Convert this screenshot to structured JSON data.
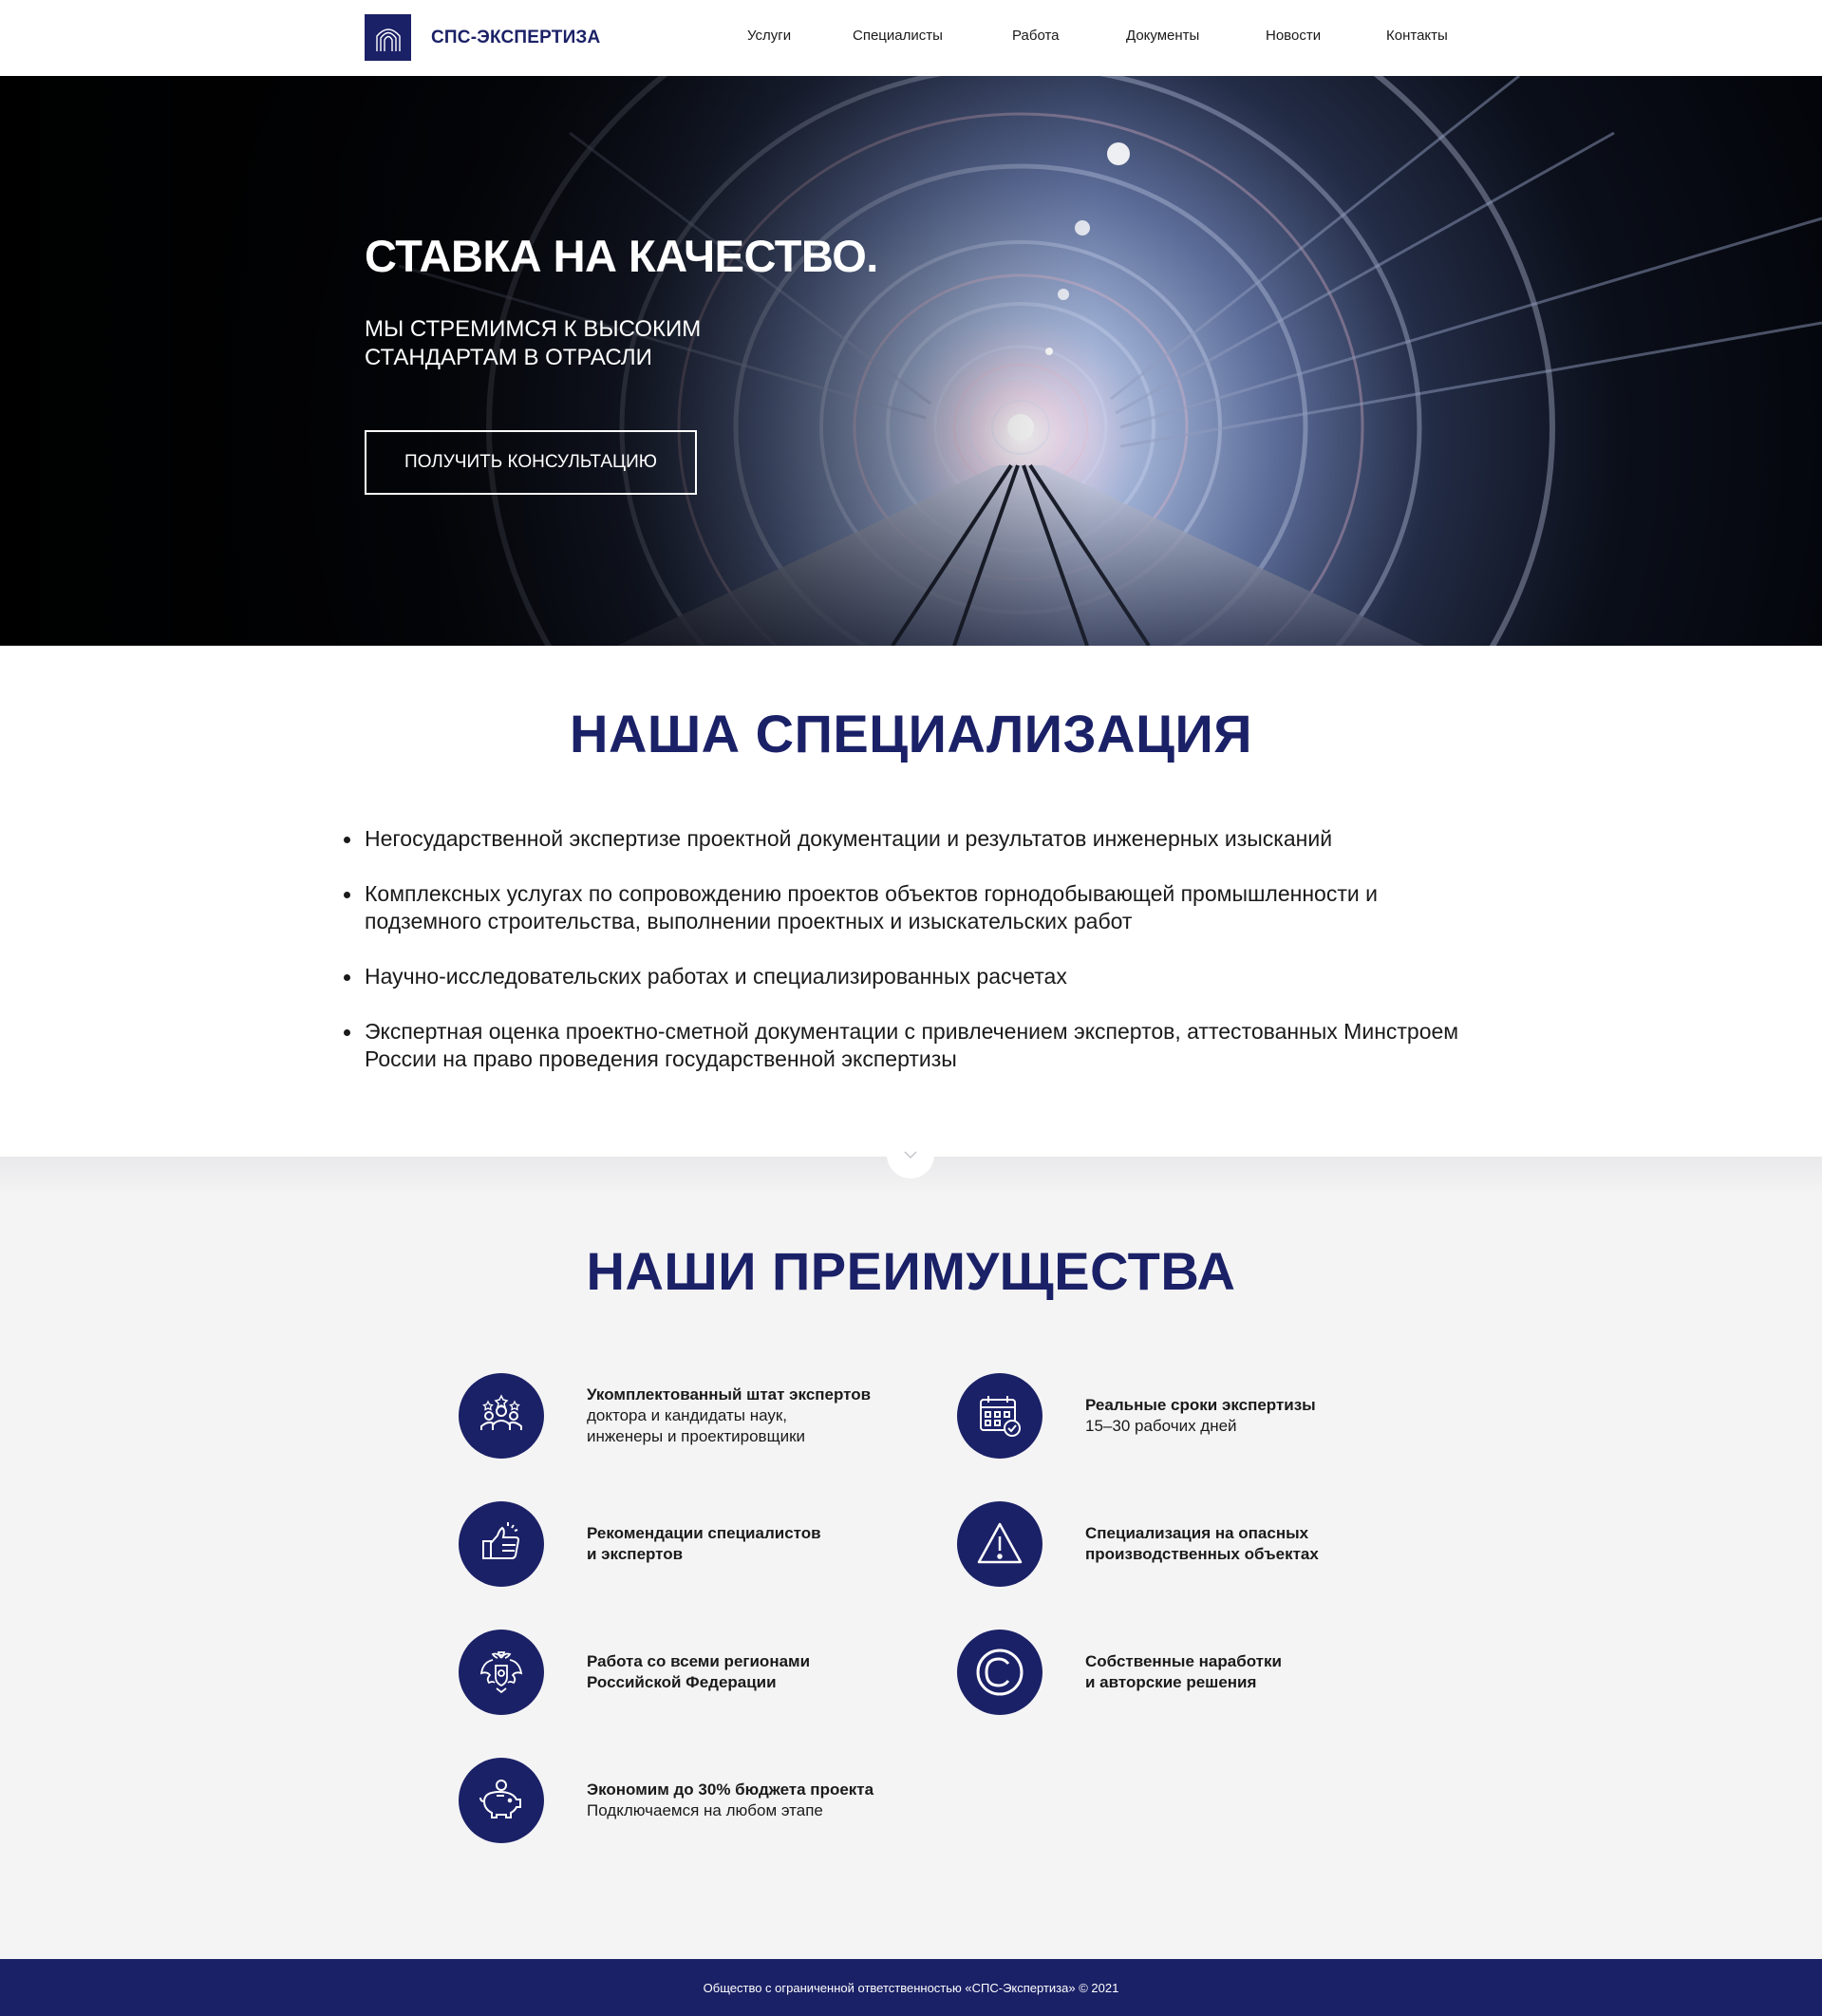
{
  "header": {
    "logo_text": "СПС-ЭКСПЕРТИЗА",
    "nav": [
      "Услуги",
      "Специалисты",
      "Работа",
      "Документы",
      "Новости",
      "Контакты"
    ]
  },
  "hero": {
    "title": "СТАВКА НА КАЧЕСТВО.",
    "subtitle": "МЫ СТРЕМИМСЯ К ВЫСОКИМ СТАНДАРТАМ В ОТРАСЛИ",
    "button": "ПОЛУЧИТЬ КОНСУЛЬТАЦИЮ"
  },
  "specialization": {
    "title": "НАША СПЕЦИАЛИЗАЦИЯ",
    "items": [
      "Негосударственной экспертизе проектной документации и результатов инженерных изысканий",
      "Комплексных услугах по сопровождению проектов объектов горнодобывающей промышленности и подземного строительства, выполнении проектных и изыскательских работ",
      "Научно-исследовательских работах и специализированных расчетах",
      "Экспертная оценка проектно-сметной документации с привлечением экспертов, аттестованных Минстроем России на право проведения государственной экспертизы"
    ]
  },
  "advantages": {
    "title": "НАШИ ПРЕИМУЩЕСТВА",
    "items": [
      {
        "icon": "team-icon",
        "title": "Укомплектованный штат экспертов",
        "desc": "доктора и кандидаты наук,\nинженеры и проектировщики"
      },
      {
        "icon": "calendar-icon",
        "title": "Реальные сроки экспертизы",
        "desc": "15–30 рабочих дней"
      },
      {
        "icon": "thumbs-up-icon",
        "title": "Рекомендации специалистов\nи экспертов",
        "desc": ""
      },
      {
        "icon": "warning-icon",
        "title": "Специализация на опасных\nпроизводственных объектах",
        "desc": ""
      },
      {
        "icon": "coat-of-arms-icon",
        "title": "Работа со всеми регионами\nРоссийской Федерации",
        "desc": ""
      },
      {
        "icon": "copyright-icon",
        "title": "Собственные наработки\nи авторские решения",
        "desc": ""
      },
      {
        "icon": "piggy-bank-icon",
        "title": "Экономим до 30% бюджета проекта",
        "desc": "Подключаемся на любом этапе"
      }
    ]
  },
  "footer": {
    "text": "Общество с ограниченной ответственностью «СПС-Экспертиза»   © 2021"
  },
  "colors": {
    "brand": "#1b2167",
    "section_bg": "#f4f4f5"
  }
}
